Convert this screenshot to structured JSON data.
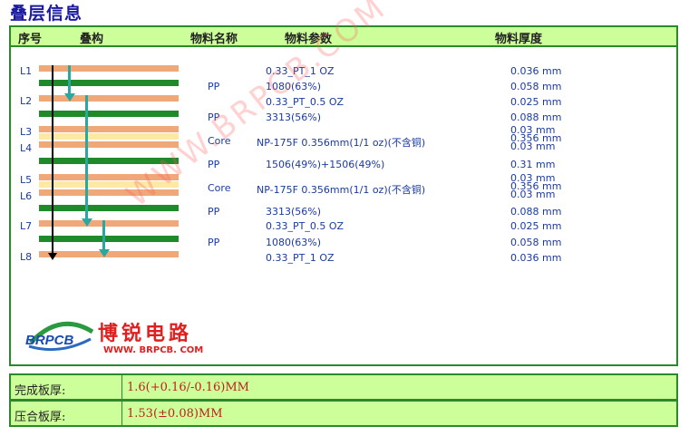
{
  "title": "叠层信息",
  "headers": {
    "no": "序号",
    "stack": "叠构",
    "name": "物料名称",
    "param": "物料参数",
    "thickness": "物料厚度"
  },
  "layer_labels": [
    "L1",
    "L2",
    "L3",
    "L4",
    "L5",
    "L6",
    "L7",
    "L8"
  ],
  "rows": [
    {
      "name": "",
      "param": "0.33_PT_1 OZ",
      "thickness": "0.036 mm"
    },
    {
      "name": "PP",
      "param": "1080(63%)",
      "thickness": "0.058 mm"
    },
    {
      "name": "",
      "param": "0.33_PT_0.5 OZ",
      "thickness": "0.025 mm"
    },
    {
      "name": "PP",
      "param": "3313(56%)",
      "thickness": "0.088 mm"
    },
    {
      "name": "Core",
      "param": "NP-175F 0.356mm(1/1 oz)(不含铜)",
      "thickness": "0.03 mm",
      "thickness2": "0.356 mm",
      "thickness3": "0.03 mm"
    },
    {
      "name": "PP",
      "param": "1506(49%)+1506(49%)",
      "thickness": "0.31 mm"
    },
    {
      "name": "Core",
      "param": "NP-175F 0.356mm(1/1 oz)(不含铜)",
      "thickness": "0.03 mm",
      "thickness2": "0.356 mm",
      "thickness3": "0.03 mm"
    },
    {
      "name": "PP",
      "param": "3313(56%)",
      "thickness": "0.088 mm"
    },
    {
      "name": "",
      "param": "0.33_PT_0.5 OZ",
      "thickness": "0.025 mm"
    },
    {
      "name": "PP",
      "param": "1080(63%)",
      "thickness": "0.058 mm"
    },
    {
      "name": "",
      "param": "0.33_PT_1 OZ",
      "thickness": "0.036 mm"
    }
  ],
  "watermark": "WWW.BRPCB.COM",
  "logo": {
    "brand": "BRPCB",
    "cn": "博锐电路",
    "url": "WWW. BRPCB. COM"
  },
  "summary": [
    {
      "key": "完成板厚:",
      "value": "1.6(+0.16/-0.16)MM"
    },
    {
      "key": "压合板厚:",
      "value": "1.53(±0.08)MM"
    }
  ],
  "colors": {
    "copper": "#f0a878",
    "prepreg": "#1f8a2a",
    "core": "#fce9a4",
    "header_bg": "#ccff99",
    "border": "#2a8a2a",
    "text_blue": "#1a3aa0",
    "accent_red": "#c02020"
  }
}
